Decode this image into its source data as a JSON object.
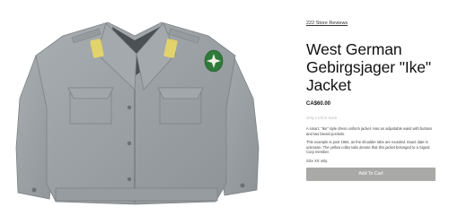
{
  "product": {
    "reviews_link": "222 Store Reviews",
    "title": "West German Gebirgsjager \"Ike\" Jacket",
    "price": "CA$60.00",
    "stock": "Only 1 left in stock",
    "description": [
      "A smart, \"Ike\" style dress uniform jacket. Has an adjustable waist with buttons and two breast pockets.",
      "This example is post 1962, as the shoulder tabs are rounded. Exact date is unknown. The yellow collar tabs denote that this jacket belonged to a Signal Corp member.",
      "Size XS only."
    ],
    "add_to_cart_label": "Add To Cart"
  },
  "colors": {
    "jacket": "#9aa0a3",
    "collar_tab": "#e2d36a",
    "badge": "#2f7a3b",
    "button": "#a9a9a7"
  },
  "icons": {
    "badge": "edelweiss-badge-icon"
  }
}
